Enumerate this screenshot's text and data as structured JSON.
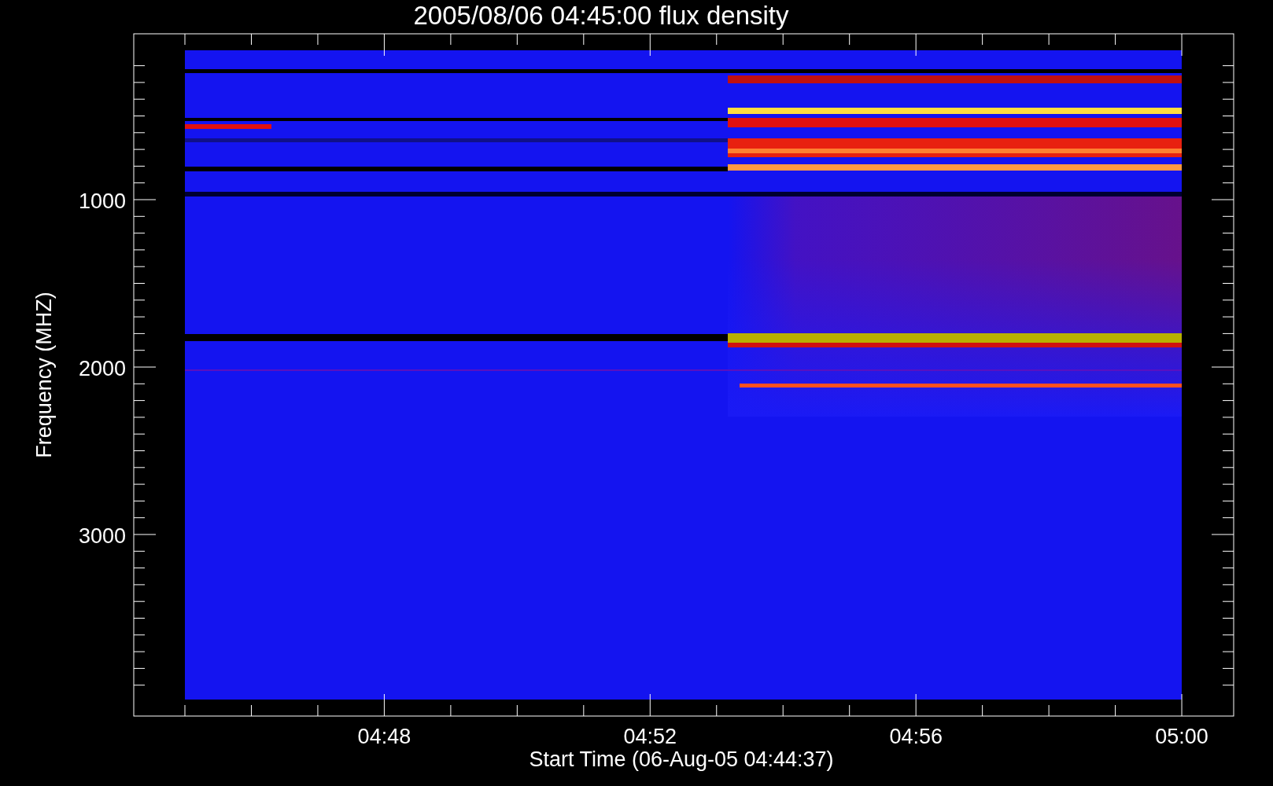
{
  "plot": {
    "title": "2005/08/06 04:45:00 flux density",
    "y_axis": {
      "label": "Frequency (MHZ)",
      "ticks": [
        "1000",
        "2000",
        "3000"
      ]
    },
    "x_axis": {
      "label": "Start Time (06-Aug-05 04:44:37)",
      "ticks": [
        "04:48",
        "04:52",
        "04:56",
        "05:00"
      ]
    }
  }
}
